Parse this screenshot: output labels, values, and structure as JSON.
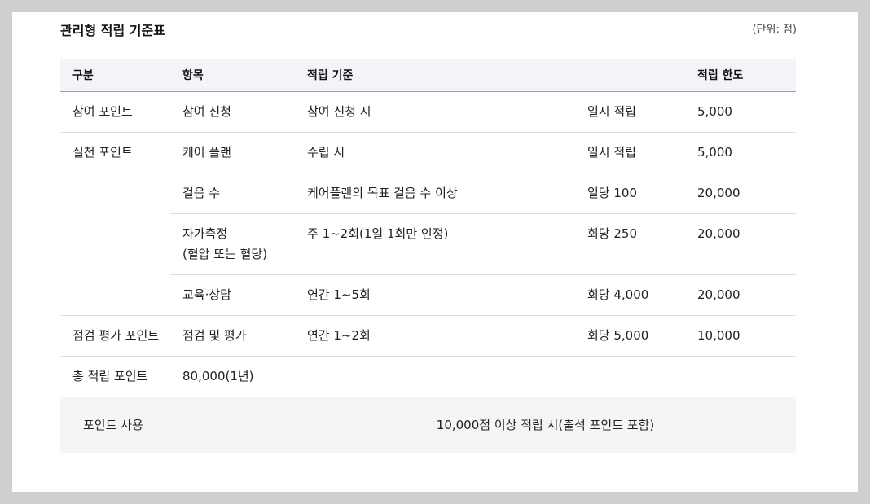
{
  "doc": {
    "title": "관리형 적립 기준표",
    "unit": "(단위: 점)"
  },
  "table": {
    "headers": [
      "구분",
      "항목",
      "적립 기준",
      "",
      "적립 한도"
    ],
    "groups": {
      "participation": "참여 포인트",
      "practice": "실천 포인트",
      "evaluation": "점검 평가 포인트"
    },
    "rows": [
      {
        "item": "참여 신청",
        "criteria": "참여 신청 시",
        "rate": "일시 적립",
        "limit": "5,000"
      },
      {
        "item": "케어 플랜",
        "criteria": "수립 시",
        "rate": "일시 적립",
        "limit": "5,000"
      },
      {
        "item": "걸음 수",
        "criteria": "케어플랜의 목표 걸음 수 이상",
        "rate": "일당 100",
        "limit": "20,000"
      },
      {
        "item": "자가측정",
        "item_note": "(혈압 또는 혈당)",
        "criteria": "주 1~2회(1일 1회만 인정)",
        "rate": "회당 250",
        "limit": "20,000"
      },
      {
        "item": "교육·상담",
        "criteria": "연간 1~5회",
        "rate": "회당 4,000",
        "limit": "20,000"
      },
      {
        "item": "점검 및 평가",
        "criteria": "연간 1~2회",
        "rate": "회당 5,000",
        "limit": "10,000"
      }
    ],
    "total": {
      "label": "총 적립 포인트",
      "value": "80,000(1년)"
    },
    "usage": {
      "label": "포인트 사용",
      "text": "10,000점 이상 적립 시(출석 포인트 포함)"
    }
  }
}
